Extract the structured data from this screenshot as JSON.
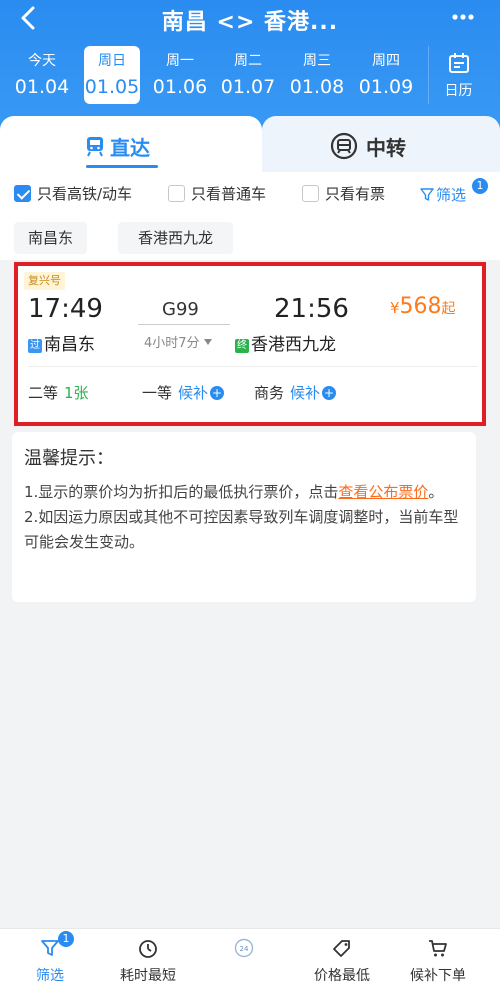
{
  "header": {
    "title": "南昌 <> 香港...",
    "back_icon": "chevron-left-icon",
    "more_icon": "more-dots-icon"
  },
  "dates": [
    {
      "weekday": "今天",
      "date": "01.04",
      "active": false
    },
    {
      "weekday": "周日",
      "date": "01.05",
      "active": true
    },
    {
      "weekday": "周一",
      "date": "01.06",
      "active": false
    },
    {
      "weekday": "周二",
      "date": "01.07",
      "active": false
    },
    {
      "weekday": "周三",
      "date": "01.08",
      "active": false
    },
    {
      "weekday": "周四",
      "date": "01.09",
      "active": false
    }
  ],
  "calendar": {
    "label": "日历",
    "icon": "calendar-icon"
  },
  "tabs": {
    "direct": {
      "label": "直达",
      "icon": "train-icon"
    },
    "transfer": {
      "label": "中转",
      "icon": "transfer-icon"
    }
  },
  "filters": {
    "high_speed": {
      "label": "只看高铁/动车",
      "checked": true
    },
    "regular": {
      "label": "只看普通车",
      "checked": false
    },
    "available": {
      "label": "只看有票",
      "checked": false
    },
    "screen": {
      "label": "筛选",
      "badge": "1"
    }
  },
  "station_chips": [
    "南昌东",
    "香港西九龙"
  ],
  "train": {
    "badge": "复兴号",
    "depart_time": "17:49",
    "arrive_time": "21:56",
    "train_no": "G99",
    "duration": "4小时7分",
    "depart_tag": "过",
    "depart_station": "南昌东",
    "arrive_tag": "终",
    "arrive_station": "香港西九龙",
    "price_currency": "¥",
    "price": "568",
    "price_suffix": "起",
    "seats": [
      {
        "class": "二等",
        "status": "1张",
        "type": "available"
      },
      {
        "class": "一等",
        "status": "候补",
        "type": "waitlist"
      },
      {
        "class": "商务",
        "status": "候补",
        "type": "waitlist"
      }
    ]
  },
  "tips": {
    "title": "温馨提示：",
    "line1_prefix": "1.显示的票价均为折扣后的最低执行票价，点击",
    "line1_link": "查看公布票价",
    "line1_suffix": "。",
    "line2": "2.如因运力原因或其他不可控因素导致列车调度调整时，当前车型可能会发生变动。"
  },
  "bottom_bar": [
    {
      "label": "筛选",
      "icon": "filter-icon",
      "badge": "1",
      "active": true
    },
    {
      "label": "耗时最短",
      "icon": "clock-icon",
      "active": false
    },
    {
      "label": "24",
      "icon": "24h-icon",
      "active": false
    },
    {
      "label": "价格最低",
      "icon": "price-tag-icon",
      "active": false
    },
    {
      "label": "候补下单",
      "icon": "cart-icon",
      "active": false
    }
  ],
  "colors": {
    "brand_blue": "#2a8cf0",
    "price_orange": "#ff7a1a",
    "highlight_red": "#e01e26",
    "seat_green": "#2bb24c"
  }
}
